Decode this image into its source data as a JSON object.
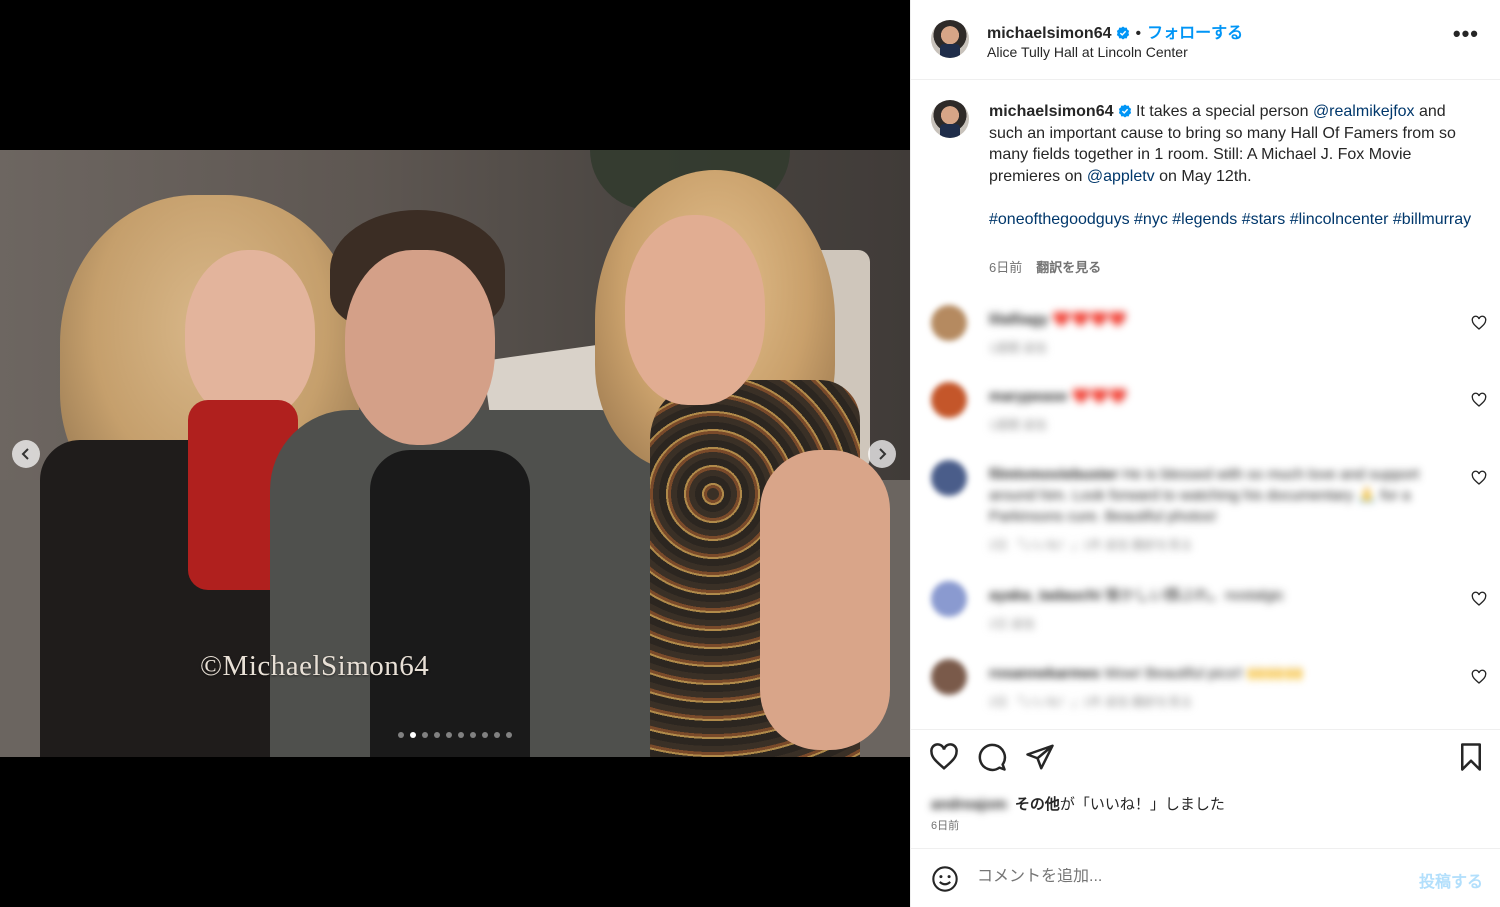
{
  "post": {
    "username": "michaelsimon64",
    "follow_label": "フォローする",
    "separator": "•",
    "location": "Alice Tully Hall at Lincoln Center",
    "more_label": "•••",
    "photo_watermark": "©MichaelSimon64",
    "carousel": {
      "count": 10,
      "active_index": 1
    }
  },
  "caption": {
    "username": "michaelsimon64",
    "text_1": "It takes a special person ",
    "mention_1": "@realmikejfox",
    "text_2": " and such an important cause to bring so many Hall Of Famers from so many fields together in 1 room. Still: A Michael J. Fox Movie premieres on ",
    "mention_2": "@appletv",
    "text_3": " on May 12th.",
    "hashtags": [
      "#oneofthegoodguys",
      "#nyc",
      "#legends",
      "#stars",
      "#lincolncenter",
      "#billmurray"
    ],
    "time": "6日前",
    "translate": "翻訳を見る"
  },
  "comments": [
    {
      "user": "lilalliagy",
      "text": "❤️❤️❤️❤️",
      "meta": "1週間  返信",
      "avatar_color": "#b58a60"
    },
    {
      "user": "marypease",
      "text": "❤️❤️❤️",
      "meta": "1週間  返信",
      "avatar_color": "#c4562a"
    },
    {
      "user": "filmtvmoviebuster",
      "text": "He is blessed with so much love and support around him. Look forward to watching his documentary 🙏 for a Parkinsons cure. Beautiful photos!",
      "meta": "2日  「いいね！」1件  返信  翻訳を見る",
      "avatar_color": "#4a5d8a"
    },
    {
      "user": "ayaka_tadauchi",
      "text": "懐かしい顔ぶれ。nostalgic",
      "meta": "2日  返信",
      "avatar_color": "#8a9ad0"
    },
    {
      "user": "rosannekarmes",
      "text": "Wow! Beautiful pics!! 🙌🙌🙌",
      "meta": "2日  「いいね！」1件  返信  翻訳を見る",
      "avatar_color": "#7a5a4a"
    }
  ],
  "likes": {
    "blurred_user": "andreajom",
    "bold_part": "その他",
    "rest": "が「いいね！」しました",
    "time": "6日前"
  },
  "comment_input": {
    "placeholder": "コメントを追加...",
    "post_label": "投稿する"
  },
  "icons": {
    "verified": "verified-badge-icon",
    "like": "heart-icon",
    "comment": "comment-bubble-icon",
    "share": "paper-plane-icon",
    "save": "bookmark-icon",
    "emoji": "smiley-icon",
    "prev": "chevron-left-icon",
    "next": "chevron-right-icon"
  },
  "colors": {
    "accent": "#0095f6",
    "link": "#00376b",
    "muted": "#737373",
    "post_disabled": "#b2dffc"
  }
}
